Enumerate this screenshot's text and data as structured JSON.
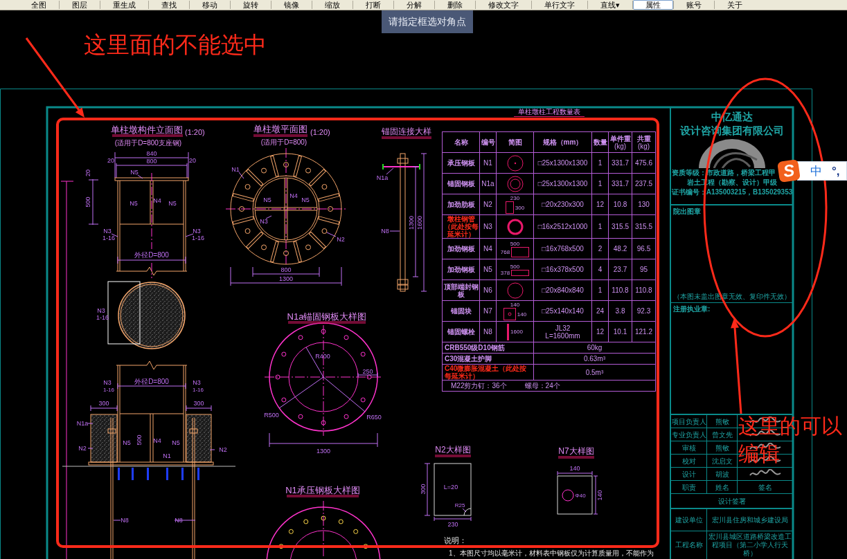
{
  "toolbar": {
    "buttons": [
      {
        "label": "全图",
        "selected": false
      },
      {
        "label": "图层",
        "selected": false
      },
      {
        "label": "重生成",
        "selected": false
      },
      {
        "label": "查找",
        "selected": false
      },
      {
        "label": "移动",
        "selected": false
      },
      {
        "label": "旋转",
        "selected": false
      },
      {
        "label": "镜像",
        "selected": false
      },
      {
        "label": "缩放",
        "selected": false
      },
      {
        "label": "打断",
        "selected": false
      },
      {
        "label": "分解",
        "selected": false
      },
      {
        "label": "删除",
        "selected": false
      },
      {
        "label": "修改文字",
        "selected": false
      },
      {
        "label": "单行文字",
        "selected": false
      },
      {
        "label": "直线▾",
        "selected": false
      },
      {
        "label": "属性",
        "selected": true
      },
      {
        "label": "账号",
        "selected": false
      },
      {
        "label": "关于",
        "selected": false
      }
    ]
  },
  "tooltip": {
    "text": "请指定框选对角点"
  },
  "annotations": [
    {
      "kind": "rounded_rect",
      "text": "这里面的不能选中"
    },
    {
      "kind": "ellipse",
      "text": "这里的可以编辑"
    }
  ],
  "drawing": {
    "views": [
      {
        "kind": "column_elevation",
        "title": "单柱墩构件立面图",
        "scale": "(1:20)",
        "subtitle": "(适用于D=800支座钢)",
        "labels": [
          "840",
          "20",
          "800",
          "20",
          "20",
          "N5",
          "500",
          "N5",
          "N4",
          "N5",
          "N3",
          "1-16",
          "N3",
          "1-16",
          "外径D=800",
          "N3",
          "1-16"
        ]
      },
      {
        "kind": "column_plan",
        "title": "单柱墩平面图",
        "scale": "(1:20)",
        "subtitle": "(适用于D=800)",
        "labels": [
          "N1",
          "N5",
          "N4",
          "N5",
          "N3",
          "N2",
          "800",
          "1300"
        ]
      },
      {
        "kind": "anchor_detail",
        "title": "锚固连接大样",
        "labels": [
          "N1a",
          "N8",
          "1300",
          "1600"
        ]
      },
      {
        "kind": "anchor_plate",
        "title": "N1a锚固钢板大样图",
        "labels": [
          "R400",
          "250",
          "R500",
          "R650",
          "1300"
        ]
      },
      {
        "kind": "stiffener_detail",
        "title": "N2大样图",
        "labels": [
          "300",
          "L=20",
          "R25",
          "230"
        ]
      },
      {
        "kind": "block_detail",
        "title": "N7大样图",
        "labels": [
          "140",
          "Φ40",
          "140"
        ]
      },
      {
        "kind": "bearing_plate",
        "title": "N1承压钢板大样图"
      },
      {
        "kind": "column_foundation",
        "labels": [
          "N3",
          "外径D=800",
          "N3",
          "1-16",
          "1-16",
          "300",
          "300",
          "N1a",
          "N2",
          "N5",
          "500",
          "N4",
          "N5",
          "N2",
          "N1",
          "N8",
          "N8"
        ]
      }
    ],
    "quantity_table": {
      "title": "单柱墩柱工程数量表",
      "columns": [
        {
          "label": "名称"
        },
        {
          "label": "编号"
        },
        {
          "label": "简图"
        },
        {
          "label": "规格（mm）"
        },
        {
          "label": "数量"
        },
        {
          "label": "单件重",
          "unit": "(kg)"
        },
        {
          "label": "共重",
          "unit": "(kg)"
        }
      ],
      "rows": [
        {
          "name": "承压钢板",
          "color": "#cf92f2",
          "id": "N1",
          "sketch": {
            "kind": "circle_dot"
          },
          "spec": [
            "□25x1300x1300"
          ],
          "quantity": "1",
          "unit_weight": "331.7",
          "total_weight": "475.6"
        },
        {
          "name": "锚固钢板",
          "color": "#cf92f2",
          "id": "N1a",
          "sketch": {
            "kind": "ring"
          },
          "spec": [
            "□25x1300x1300"
          ],
          "quantity": "1",
          "unit_weight": "331.7",
          "total_weight": "237.5"
        },
        {
          "name": "加劲肋板",
          "color": "#cf92f2",
          "id": "N2",
          "sketch": {
            "kind": "rect_top_right",
            "labels": [
              "230",
              "300"
            ]
          },
          "spec": [
            "□20x230x300"
          ],
          "quantity": "12",
          "unit_weight": "10.8",
          "total_weight": "130"
        },
        {
          "name": "墩柱钢管（此处按每延米计）",
          "color": "#ff2a1a",
          "id": "N3",
          "sketch": {
            "kind": "tube"
          },
          "spec": [
            "□16x2512x1000"
          ],
          "quantity": "1",
          "unit_weight": "315.5",
          "total_weight": "315.5"
        },
        {
          "name": "加劲钢板",
          "color": "#cf92f2",
          "id": "N4",
          "sketch": {
            "kind": "rect_top_left",
            "labels": [
              "500",
              "768"
            ]
          },
          "spec": [
            "□16x768x500"
          ],
          "quantity": "2",
          "unit_weight": "48.2",
          "total_weight": "96.5"
        },
        {
          "name": "加劲钢板",
          "color": "#cf92f2",
          "id": "N5",
          "sketch": {
            "kind": "flat_rect_top_left",
            "labels": [
              "500",
              "378"
            ]
          },
          "spec": [
            "□16x378x500"
          ],
          "quantity": "4",
          "unit_weight": "23.7",
          "total_weight": "95"
        },
        {
          "name": "顶部端封钢板",
          "color": "#cf92f2",
          "id": "N6",
          "sketch": {
            "kind": "circle"
          },
          "spec": [
            "□20x840x840"
          ],
          "quantity": "1",
          "unit_weight": "110.8",
          "total_weight": "110.8"
        },
        {
          "name": "锚固块",
          "color": "#cf92f2",
          "id": "N7",
          "sketch": {
            "kind": "square_hole",
            "labels": [
              "140",
              "140"
            ]
          },
          "spec": [
            "□25x140x140"
          ],
          "quantity": "24",
          "unit_weight": "3.8",
          "total_weight": "92.3"
        },
        {
          "name": "锚固螺栓",
          "color": "#cf92f2",
          "id": "N8",
          "sketch": {
            "kind": "bolt",
            "labels": [
              "1600"
            ]
          },
          "spec": [
            "JL32",
            "L=1600mm"
          ],
          "quantity": "12",
          "unit_weight": "10.1",
          "total_weight": "121.2"
        }
      ],
      "materials": [
        {
          "name": "CRB550级D10钢筋",
          "color": "#cf92f2",
          "amount": "60kg"
        },
        {
          "name": "C30混凝土护脚",
          "color": "#cf92f2",
          "amount": "0.63m³"
        },
        {
          "name": "C40微膨胀混凝土（此处按每延米计）",
          "color": "#ff2a1a",
          "amount": "0.5m³"
        }
      ],
      "fasteners": [
        "M22剪力钉：36个",
        "螺母：24个"
      ]
    },
    "notes": {
      "heading": "说明：",
      "lines": [
        "1、本图尺寸均以毫米计，材料表中钢板仅为计算质量用，不能作为"
      ]
    },
    "title_block": {
      "company": [
        "中亿通达",
        "设计咨询集团有限公司"
      ],
      "qualifications": [
        "资质等级：市政道路，桥梁工程甲",
        "岩土工程（勘察、设计）甲级",
        "证书编号：A135003215，B135029353"
      ],
      "seal_label": "院出图章",
      "seal_note": "（本图未盖出图章无效、复印件无效）",
      "registration_label": "注册执业章:",
      "signatures": [
        {
          "role": "项目负责人",
          "name": "熊敏",
          "signed": true
        },
        {
          "role": "专业负责人",
          "name": "曾文先",
          "signed": true
        },
        {
          "role": "审核",
          "name": "熊敏",
          "signed": true
        },
        {
          "role": "校对",
          "name": "沈启文",
          "signed": true
        },
        {
          "role": "设计",
          "name": "胡波",
          "signed": true
        }
      ],
      "signature_header": [
        "职责",
        "姓名",
        "签名"
      ],
      "sign_off_label": "设计签署",
      "client_label": "建设单位",
      "client": "宏川县住房和城乡建设局",
      "project_label": "工程名称",
      "project": "宏川县城区道路桥梁改造工程项目（第二小学人行天桥）"
    }
  },
  "ime_indicator": {
    "logo": "S",
    "mode": "中",
    "punctuation": "°,"
  }
}
